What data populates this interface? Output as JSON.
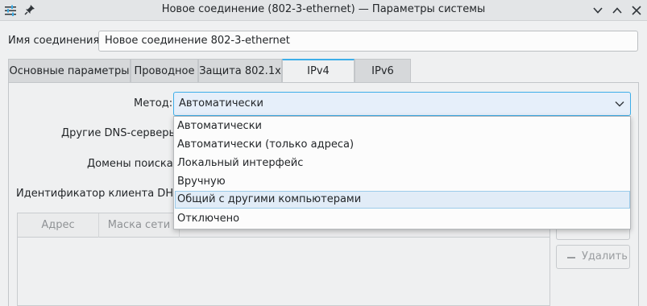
{
  "window": {
    "title": "Новое соединение (802-3-ethernet) — Параметры системы"
  },
  "connection_name": {
    "label": "Имя соединения:",
    "value": "Новое соединение 802-3-ethernet"
  },
  "tabs": [
    {
      "label": "Основные параметры"
    },
    {
      "label": "Проводное"
    },
    {
      "label": "Защита 802.1x"
    },
    {
      "label": "IPv4"
    },
    {
      "label": "IPv6"
    }
  ],
  "active_tab": "IPv4",
  "ipv4": {
    "method_label": "Метод:",
    "method_value": "Автоматически",
    "dns_label": "Другие DNS-серверы:",
    "search_label": "Домены поиска:",
    "dhcp_label": "Идентификатор клиента DHCP:",
    "method_options": [
      "Автоматически",
      "Автоматически (только адреса)",
      "Локальный интерфейс",
      "Вручную",
      "Общий с другими компьютерами",
      "Отключено"
    ],
    "highlighted_option": "Общий с другими компьютерами",
    "table_columns": [
      "Адрес",
      "Маска сети"
    ],
    "remove_button": "Удалить"
  },
  "colors": {
    "accent": "#3daee9",
    "highlight": "#e1ecf7",
    "window_bg": "#eff0f1"
  }
}
